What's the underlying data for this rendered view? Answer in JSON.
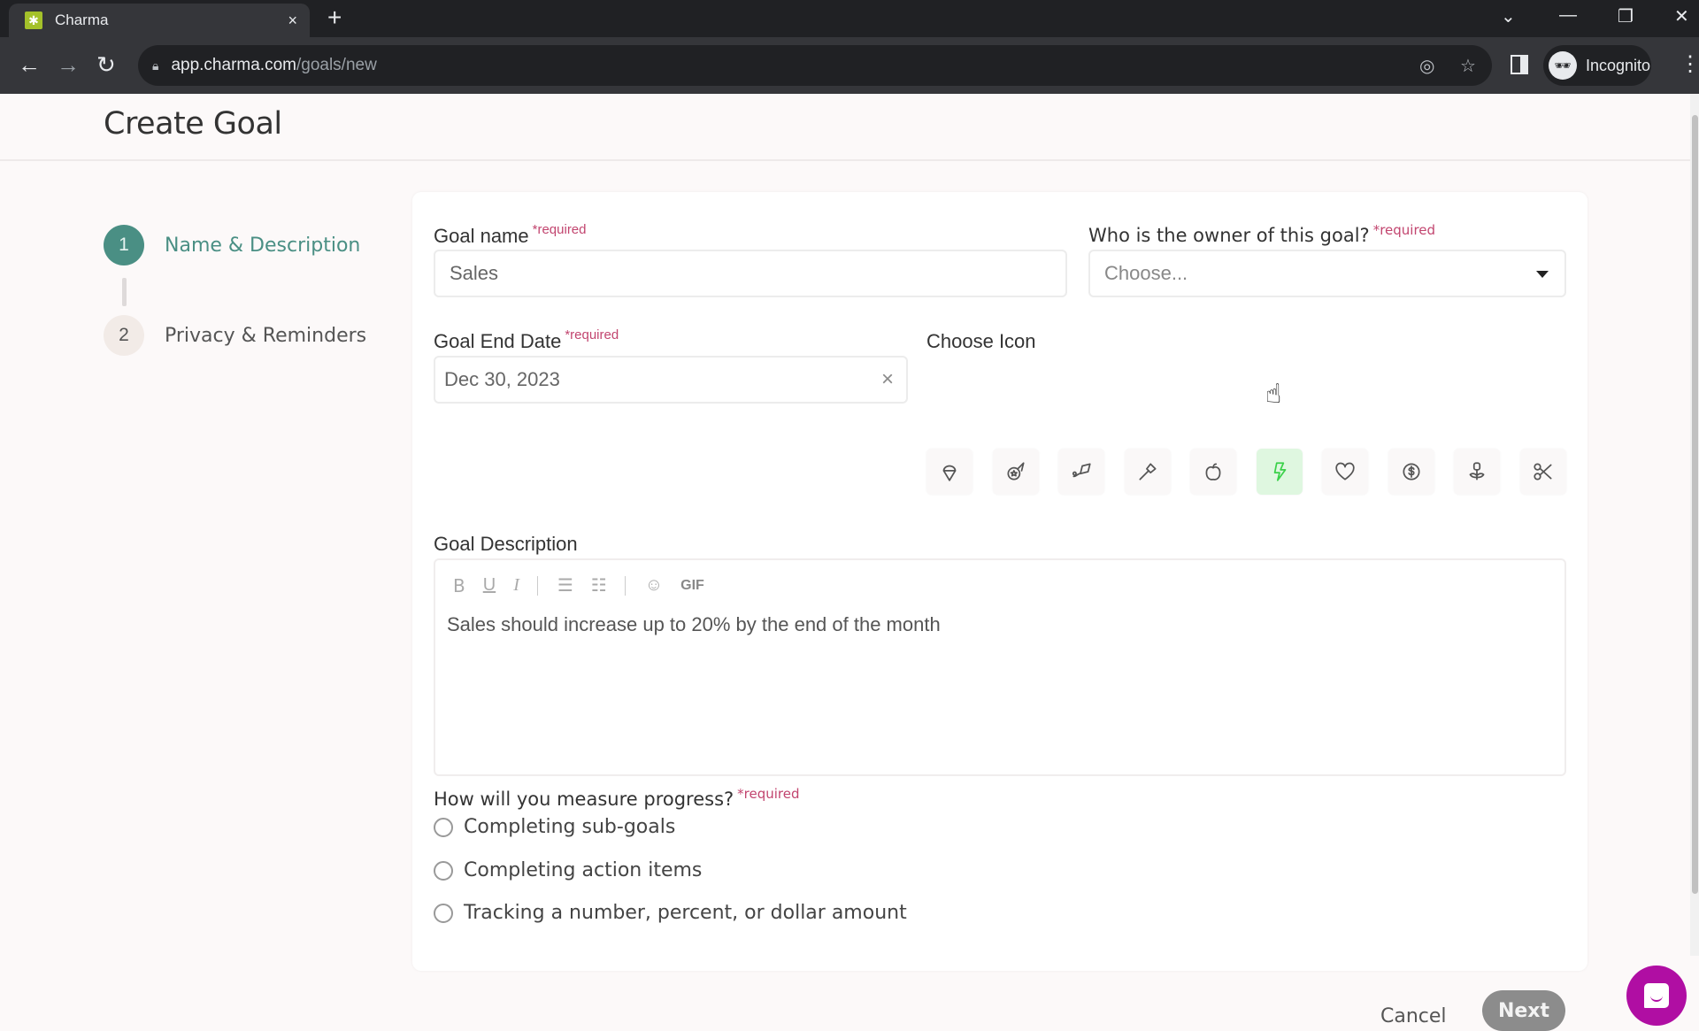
{
  "browser": {
    "tab_title": "Charma",
    "tab_close": "×",
    "new_tab": "+",
    "url_host": "app.charma.com",
    "url_path": "/goals/new",
    "profile_label": "Incognito",
    "icons": [
      "back-icon",
      "forward-icon",
      "reload-icon",
      "lock-icon",
      "eye-off-icon",
      "star-icon",
      "side-panel-icon",
      "incognito-icon",
      "more-icon"
    ]
  },
  "page": {
    "title": "Create Goal"
  },
  "steps": [
    {
      "number": "1",
      "label": "Name & Description",
      "active": true
    },
    {
      "number": "2",
      "label": "Privacy & Reminders",
      "active": false
    }
  ],
  "form": {
    "goal_name": {
      "label": "Goal name",
      "required": "*required",
      "value": "Sales"
    },
    "owner": {
      "label": "Who is the owner of this goal?",
      "required": "*required",
      "placeholder": "Choose..."
    },
    "end_date": {
      "label": "Goal End Date",
      "required": "*required",
      "value": "Dec 30, 2023",
      "clear": "×"
    },
    "choose_icon": {
      "label": "Choose Icon",
      "options": [
        "ice-cream",
        "meteor",
        "kite",
        "hammer",
        "apple",
        "lightning",
        "heart",
        "dollar-badge",
        "flower",
        "scissors"
      ],
      "selected": "lightning"
    },
    "description": {
      "label": "Goal Description",
      "toolbar": {
        "bold": "B",
        "underline": "U",
        "italic": "I",
        "gif": "GIF"
      },
      "value": "Sales should increase up to 20% by the end of the month"
    },
    "measure": {
      "label": "How will you measure progress?",
      "required": "*required",
      "options": [
        "Completing sub-goals",
        "Completing action items",
        "Tracking a number, percent, or dollar amount"
      ],
      "selected": null
    }
  },
  "actions": {
    "cancel": "Cancel",
    "next": "Next"
  },
  "colors": {
    "accent": "#4a8f84",
    "required": "#c2456f",
    "selected_icon": "#3bd14a",
    "chat": "#b00ea3"
  }
}
